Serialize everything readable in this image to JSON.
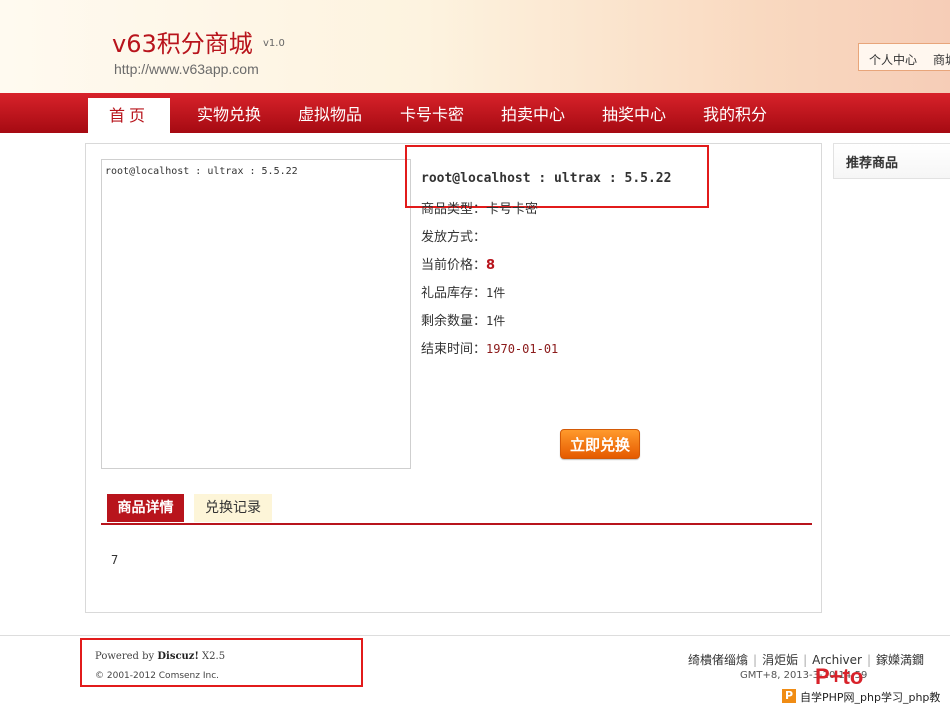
{
  "header": {
    "title": "v63积分商城",
    "version": "v1.0",
    "url": "http://www.v63app.com",
    "user_links": [
      "个人中心",
      "商城"
    ]
  },
  "nav": {
    "items": [
      {
        "label": "首页"
      },
      {
        "label": "实物兑换"
      },
      {
        "label": "虚拟物品"
      },
      {
        "label": "卡号卡密"
      },
      {
        "label": "拍卖中心"
      },
      {
        "label": "抽奖中心"
      },
      {
        "label": "我的积分"
      }
    ]
  },
  "goods": {
    "image_text": "root@localhost : ultrax : 5.5.22",
    "name": "root@localhost : ultrax : 5.5.22",
    "type_label": "商品类型：",
    "type_value": "卡号卡密",
    "delivery_label": "发放方式：",
    "delivery_value": "",
    "price_label": "当前价格：",
    "price_value": "8",
    "stock_label": "礼品库存：",
    "stock_value": "1件",
    "remaining_label": "剩余数量：",
    "remaining_value": "1件",
    "end_label": "结束时间：",
    "end_value": "1970-01-01",
    "redeem_button": "立即兑换"
  },
  "tabs": {
    "detail": "商品详情",
    "records": "兑换记录",
    "detail_content": "7"
  },
  "sidebar": {
    "title": "推荐商品"
  },
  "footer": {
    "powered_prefix": "Powered by ",
    "powered_brand": "Discuz!",
    "powered_version": " X2.5",
    "copyright": "© 2001-2012 Comsenz Inc.",
    "links": [
      "绮樻偖缁熻",
      "涓炬姤",
      "Archiver",
      "鎵嬫満鐗"
    ],
    "gmt": "GMT+8, 2013-3-20 14:59"
  },
  "watermark": {
    "logo": "P",
    "text": "自学PHP网_php学习_php教",
    "brand": "P+to"
  },
  "colors": {
    "accent": "#b8141c",
    "nav_bg": "#c8161e",
    "button": "#f07a10",
    "highlight_box": "#e21b1b"
  }
}
